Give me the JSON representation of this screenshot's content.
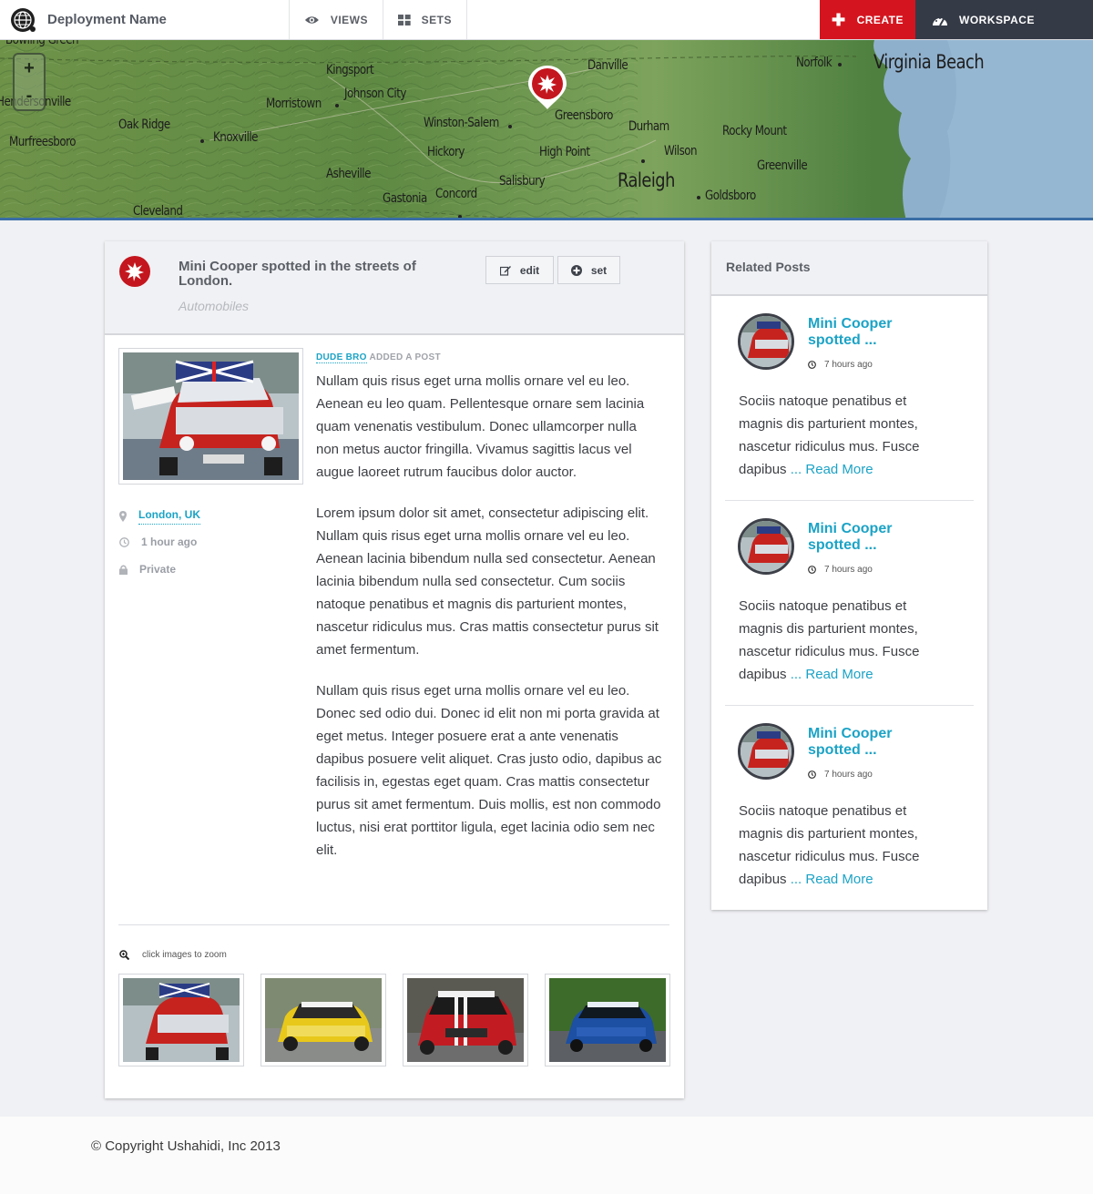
{
  "header": {
    "deployment_name": "Deployment Name",
    "views_label": "VIEWS",
    "sets_label": "SETS",
    "create_label": "CREATE",
    "workspace_label": "WORKSPACE"
  },
  "map": {
    "zoom_in": "+",
    "zoom_out": "-",
    "labels": [
      "Bowling Green",
      "Hendersonville",
      "Murfreesboro",
      "Oak Ridge",
      "Knoxville",
      "Kingsport",
      "Johnson City",
      "Morristown",
      "Asheville",
      "Cleveland",
      "Winston-Salem",
      "Hickory",
      "Gastonia",
      "Concord",
      "Salisbury",
      "High Point",
      "Greensboro",
      "Danville",
      "Durham",
      "Raleigh",
      "Wilson",
      "Rocky Mount",
      "Greenville",
      "Goldsboro",
      "Norfolk",
      "Virginia Beach"
    ]
  },
  "post": {
    "title": "Mini Cooper spotted in the streets of London.",
    "category": "Automobiles",
    "edit_label": "edit",
    "set_label": "set",
    "author": "DUDE BRO",
    "action": "ADDED A POST",
    "location": "London, UK",
    "time": "1 hour ago",
    "visibility": "Private",
    "paragraphs": [
      "Nullam quis risus eget urna mollis ornare vel eu leo. Aenean eu leo quam. Pellentesque ornare sem lacinia quam venenatis vestibulum. Donec ullamcorper nulla non metus auctor fringilla. Vivamus sagittis lacus vel augue laoreet rutrum faucibus dolor auctor.",
      "Lorem ipsum dolor sit amet, consectetur adipiscing elit. Nullam quis risus eget urna mollis ornare vel eu leo. Aenean lacinia bibendum nulla sed consectetur. Aenean lacinia bibendum nulla sed consectetur. Cum sociis natoque penatibus et magnis dis parturient montes, nascetur ridiculus mus. Cras mattis consectetur purus sit amet fermentum.",
      "Nullam quis risus eget urna mollis ornare vel eu leo. Donec sed odio dui. Donec id elit non mi porta gravida at eget metus. Integer posuere erat a ante venenatis dapibus posuere velit aliquet. Cras justo odio, dapibus ac facilisis in, egestas eget quam. Cras mattis consectetur purus sit amet fermentum. Duis mollis, est non commodo luctus, nisi erat porttitor ligula, eget lacinia odio sem nec elit."
    ],
    "zoom_hint": "click images to zoom"
  },
  "related": {
    "heading": "Related Posts",
    "items": [
      {
        "title": "Mini Cooper spotted ...",
        "time": "7 hours ago",
        "excerpt": "Sociis natoque penatibus et magnis dis parturient montes, nascetur ridiculus mus. Fusce dapibus",
        "read_more": "... Read More"
      },
      {
        "title": "Mini Cooper spotted ...",
        "time": "7 hours ago",
        "excerpt": "Sociis natoque penatibus et magnis dis parturient montes, nascetur ridiculus mus. Fusce dapibus",
        "read_more": "... Read More"
      },
      {
        "title": "Mini Cooper spotted ...",
        "time": "7 hours ago",
        "excerpt": "Sociis natoque penatibus et magnis dis parturient montes, nascetur ridiculus mus. Fusce dapibus",
        "read_more": "... Read More"
      }
    ]
  },
  "footer": {
    "copyright": "© Copyright Ushahidi, Inc 2013"
  },
  "colors": {
    "accent": "#1ba3c6",
    "create": "#d4151f",
    "workspace": "#343a46",
    "map_border": "#3a6ea5"
  },
  "icons": [
    "globe-logo-icon",
    "eye-icon",
    "grid-icon",
    "plus-icon",
    "dashboard-icon",
    "map-pin-icon",
    "edit-icon",
    "plus-circle-icon",
    "location-icon",
    "clock-icon",
    "lock-icon",
    "zoom-icon"
  ]
}
